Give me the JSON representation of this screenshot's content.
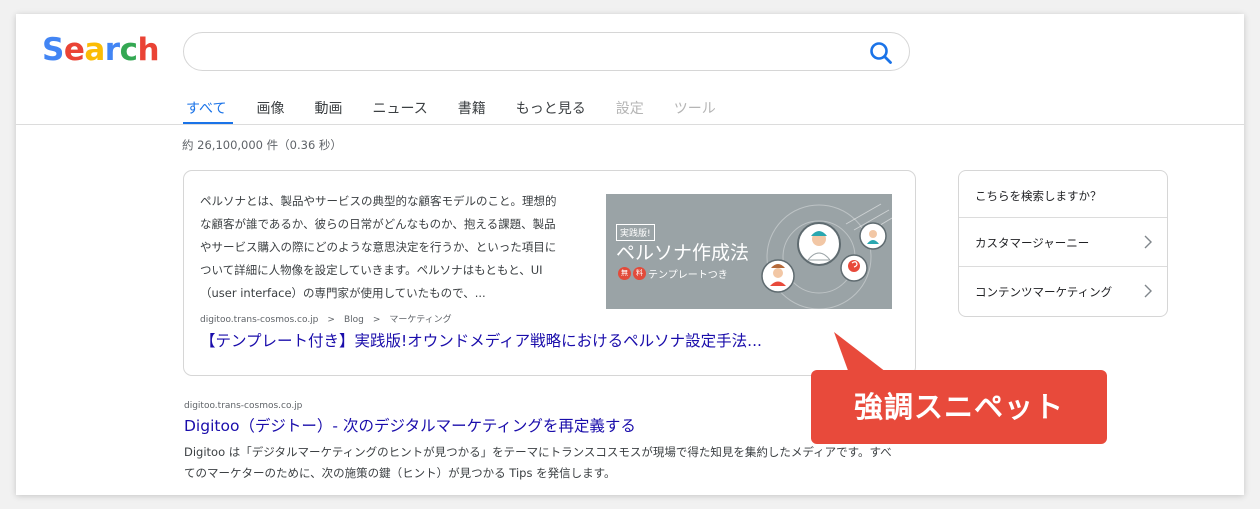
{
  "logo": {
    "letters": [
      "S",
      "e",
      "a",
      "r",
      "c",
      "h"
    ]
  },
  "colors": {
    "logo": [
      "#4285f4",
      "#ea4335",
      "#fbbc05",
      "#4285f4",
      "#34a853",
      "#ea4335"
    ],
    "accent": "#1a73e8",
    "link": "#1a0dab",
    "callout": "#e84a3b"
  },
  "search": {
    "value": "",
    "icon": "search-icon"
  },
  "tabs": [
    {
      "label": "すべて"
    },
    {
      "label": "画像"
    },
    {
      "label": "動画"
    },
    {
      "label": "ニュース"
    },
    {
      "label": "書籍"
    },
    {
      "label": "もっと見る"
    },
    {
      "label": "設定"
    },
    {
      "label": "ツール"
    }
  ],
  "result_stats": "約 26,100,000 件（0.36 秒）",
  "snippet": {
    "text_lines": [
      "ペルソナとは、製品やサービスの典型的な顧客モデルのこと。理想的",
      "な顧客が誰であるか、彼らの日常がどんなものか、抱える課題、製品",
      "やサービス購入の際にどのような意思決定を行うか、といった項目に",
      "ついて詳細に人物像を設定していきます。ペルソナはもともと、UI",
      "（user interface）の専門家が使用していたもので、..."
    ],
    "thumbnail": {
      "tag": "実践版!",
      "title": "ペルソナ作成法",
      "badge_chars": [
        "無",
        "料"
      ],
      "badge_rest": "テンプレートつき"
    },
    "breadcrumb": [
      "digitoo.trans-cosmos.co.jp",
      ">",
      "Blog",
      ">",
      "マーケティング"
    ],
    "title": "【テンプレート付き】実践版!オウンドメディア戦略におけるペルソナ設定手法..."
  },
  "sidebar": {
    "heading": "こちらを検索しますか？",
    "items": [
      {
        "label": "カスタマージャーニー"
      },
      {
        "label": "コンテンツマーケティング"
      }
    ]
  },
  "result": {
    "url": "digitoo.trans-cosmos.co.jp",
    "title": "Digitoo（デジトー）- 次のデジタルマーケティングを再定義する",
    "desc_lines": [
      "Digitoo は「デジタルマーケティングのヒントが見つかる」をテーマにトランスコスモスが現場で得た知見を集約したメディアです。すべ",
      "てのマーケターのために、次の施策の鍵（ヒント）が見つかる Tips を発信します。"
    ]
  },
  "callout": {
    "label": "強調スニペット"
  }
}
